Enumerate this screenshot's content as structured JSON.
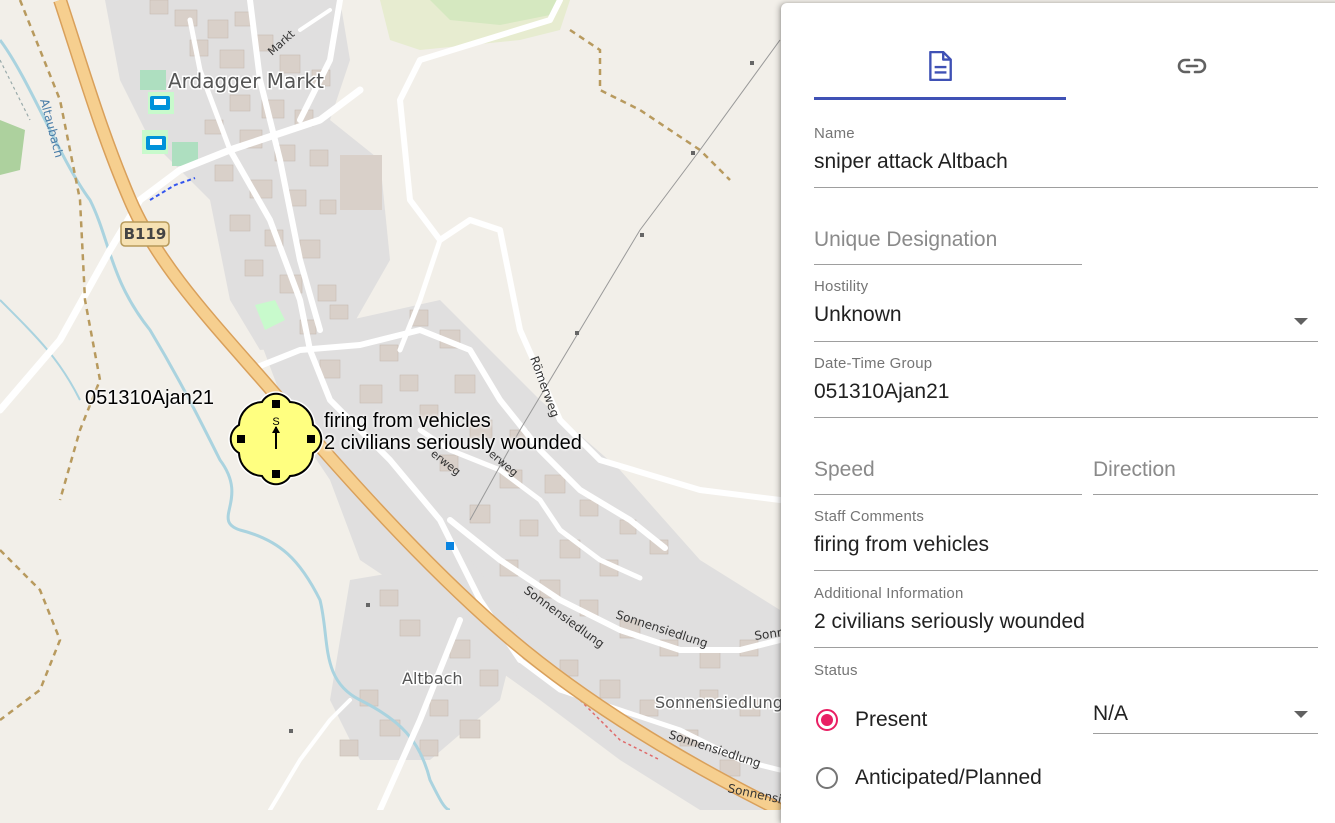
{
  "map": {
    "places": {
      "ardagger_markt": "Ardagger Markt",
      "altbach": "Altbach",
      "sonnensiedlung": "Sonnensiedlung"
    },
    "streets": {
      "markt": "Markt",
      "roemerweg": "Römerweg",
      "erweg_1": "erweg",
      "erweg_2": "erweg",
      "sonnensiedlung_1": "Sonnensiedlung",
      "sonnensiedlung_2": "Sonnensiedlung",
      "sonnensiedlung_3": "Sonnensiedlung",
      "sonnensiedlung_4": "Sonnensiedlung",
      "sonnensiedlung_5": "Sonnensiedlung"
    },
    "water": {
      "altaubach": "Altaubach"
    },
    "road_shield": "B119",
    "symbol": {
      "dtg": "051310Ajan21",
      "line1": "firing from vehicles",
      "line2": "2 civilians seriously wounded",
      "glyph": "S",
      "fill_color": "#ffff80"
    },
    "colors": {
      "background": "#f2efe9",
      "residential": "#e0dfdf",
      "building": "#d9d0c9",
      "main_road": "#f6cf8f",
      "water": "#aad3df",
      "park": "#c8facc"
    }
  },
  "panel": {
    "tabs": [
      {
        "name": "general",
        "icon": "document-icon",
        "active": true
      },
      {
        "name": "links",
        "icon": "link-icon",
        "active": false
      }
    ],
    "accent_color": "#3f51b5",
    "fields": {
      "name": {
        "label": "Name",
        "value": "sniper attack Altbach"
      },
      "unique_designation": {
        "placeholder": "Unique Designation",
        "value": ""
      },
      "hostility": {
        "label": "Hostility",
        "value": "Unknown"
      },
      "dtg": {
        "label": "Date-Time Group",
        "value": "051310Ajan21"
      },
      "speed": {
        "placeholder": "Speed",
        "value": ""
      },
      "direction": {
        "placeholder": "Direction",
        "value": ""
      },
      "staff_comments": {
        "label": "Staff Comments",
        "value": "firing from vehicles"
      },
      "additional_information": {
        "label": "Additional Information",
        "value": "2 civilians seriously wounded"
      },
      "status": {
        "label": "Status",
        "options": [
          "Present",
          "Anticipated/Planned"
        ],
        "selected": "Present",
        "radio_color": "#e91e63",
        "modifier": "N/A"
      }
    }
  }
}
